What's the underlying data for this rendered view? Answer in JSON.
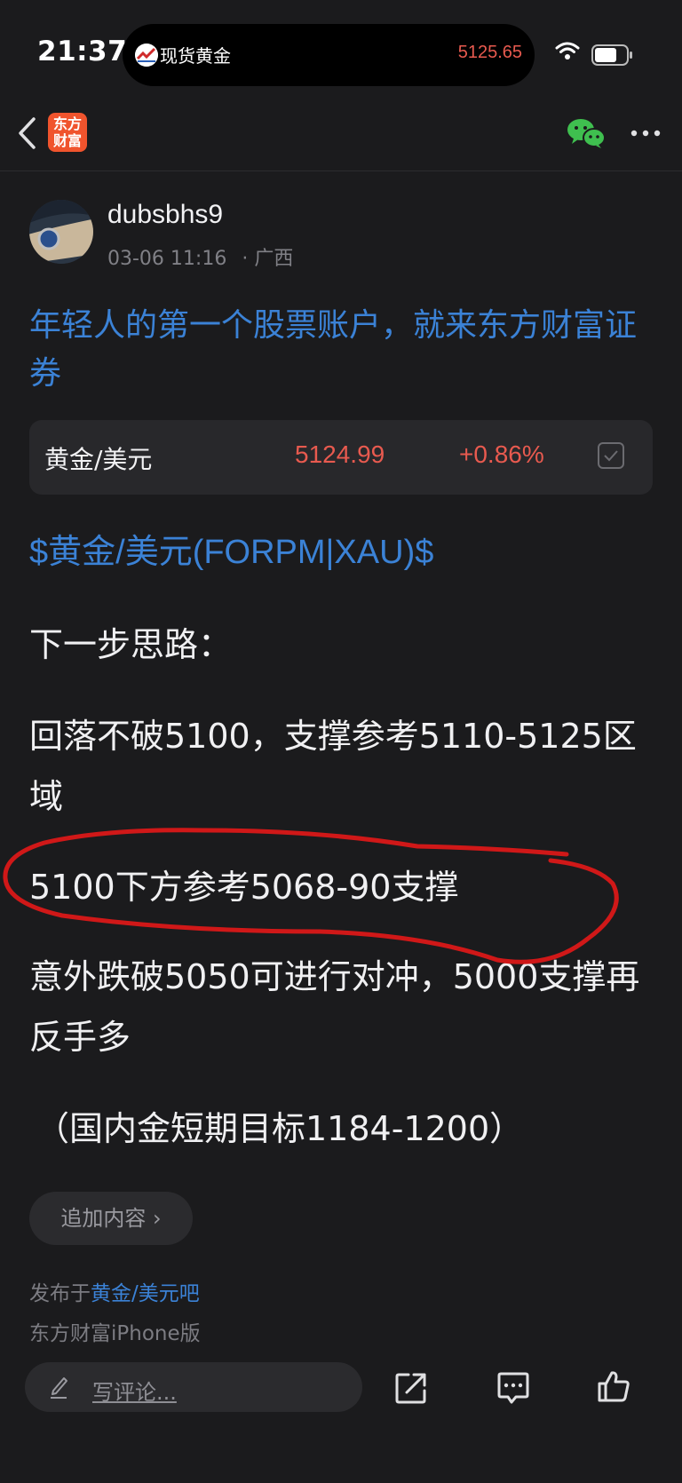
{
  "status_bar": {
    "time": "21:37",
    "live_activity": {
      "name": "现货黄金",
      "price": "5125.65"
    }
  },
  "nav": {
    "app_logo_line1": "东方",
    "app_logo_line2": "财富",
    "icons": [
      "back-icon",
      "wechat-icon",
      "more-icon"
    ]
  },
  "post": {
    "author": "dubsbhs9",
    "date": "03-06 11:16",
    "location": "· 广西",
    "ad_text": "年轻人的第一个股票账户，就来东方财富证券",
    "quote": {
      "name": "黄金/美元",
      "price": "5124.99",
      "change": "+0.86%"
    },
    "stock_tag": "$黄金/美元(FORPM|XAU)$",
    "paragraphs": [
      "下一步思路：",
      "回落不破5100，支撑参考5110-5125区域",
      "5100下方参考5068-90支撑",
      "意外跌破5050可进行对冲，5000支撑再反手多",
      "（国内金短期目标1184-1200）"
    ],
    "add_content": "追加内容 ›",
    "posted_prefix": "发布于",
    "posted_forum": "黄金/美元吧",
    "device": "东方财富iPhone版"
  },
  "bottom_bar": {
    "comment_placeholder": "写评论..."
  },
  "colors": {
    "accent_blue": "#3b82d6",
    "price_red": "#e85a4f",
    "annotation_red": "#d01818",
    "background": "#1b1b1d"
  }
}
